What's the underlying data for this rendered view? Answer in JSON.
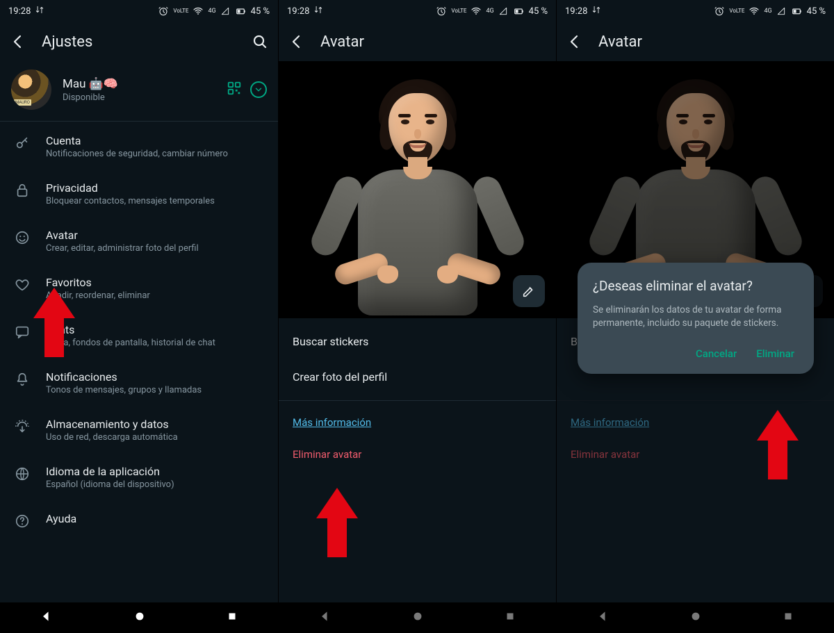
{
  "status": {
    "time": "19:28",
    "volte": "VoLTE",
    "net": "4G",
    "battery_pct": "45 %"
  },
  "screen1": {
    "title": "Ajustes",
    "profile": {
      "name": "Mau 🤖🧠",
      "status": "Disponible"
    },
    "items": [
      {
        "icon": "key",
        "title": "Cuenta",
        "sub": "Notificaciones de seguridad, cambiar número"
      },
      {
        "icon": "lock",
        "title": "Privacidad",
        "sub": "Bloquear contactos, mensajes temporales"
      },
      {
        "icon": "face",
        "title": "Avatar",
        "sub": "Crear, editar, administrar foto del perfil"
      },
      {
        "icon": "heart",
        "title": "Favoritos",
        "sub": "Añadir, reordenar, eliminar"
      },
      {
        "icon": "chat",
        "title": "Chats",
        "sub": "Tema, fondos de pantalla, historial de chat"
      },
      {
        "icon": "bell",
        "title": "Notificaciones",
        "sub": "Tonos de mensajes, grupos y llamadas"
      },
      {
        "icon": "data",
        "title": "Almacenamiento y datos",
        "sub": "Uso de red, descarga automática"
      },
      {
        "icon": "globe",
        "title": "Idioma de la aplicación",
        "sub": "Español (idioma del dispositivo)"
      },
      {
        "icon": "help",
        "title": "Ayuda",
        "sub": ""
      }
    ]
  },
  "screen2": {
    "title": "Avatar",
    "menu": {
      "find_stickers": "Buscar stickers",
      "create_photo": "Crear foto del perfil",
      "more_info": "Más información",
      "delete": "Eliminar avatar"
    }
  },
  "screen3": {
    "title": "Avatar",
    "menu": {
      "find_prefix": "B",
      "more_info": "Más información",
      "delete": "Eliminar avatar"
    },
    "dialog": {
      "title": "¿Deseas eliminar el avatar?",
      "body": "Se eliminarán los datos de tu avatar de forma permanente, incluido su paquete de stickers.",
      "cancel": "Cancelar",
      "confirm": "Eliminar"
    }
  }
}
